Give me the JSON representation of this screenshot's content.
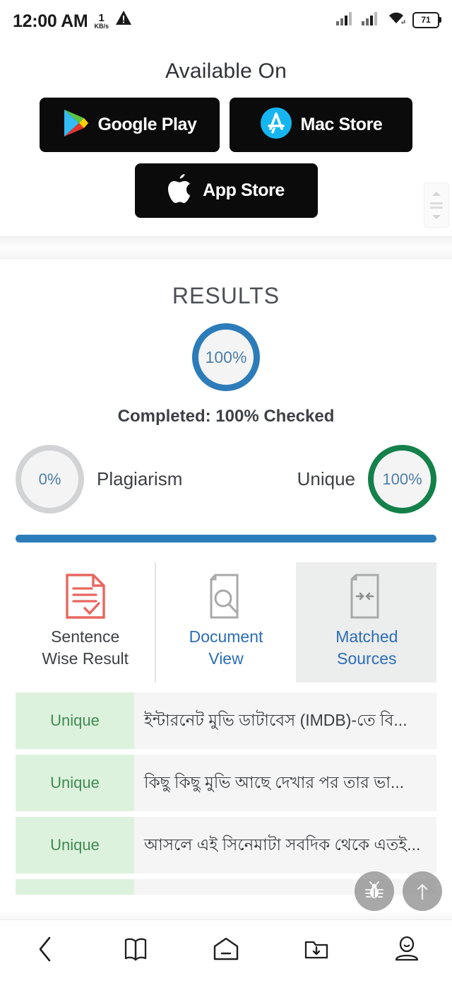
{
  "statusbar": {
    "time": "12:00 AM",
    "net_speed_value": "1",
    "net_speed_unit": "KB/s",
    "warning_icon": "warning-triangle-icon",
    "signal1_icon": "signal-bars-icon",
    "signal2_icon": "signal-bars-icon",
    "wifi_icon": "wifi-icon",
    "battery_level": "71"
  },
  "available": {
    "title": "Available On",
    "badges": [
      {
        "label": "Google Play",
        "icon": "google-play-icon"
      },
      {
        "label": "Mac Store",
        "icon": "mac-store-icon"
      },
      {
        "label": "App Store",
        "icon": "apple-icon"
      }
    ]
  },
  "scroll_widget": {
    "up_icon": "chevron-up-icon",
    "down_icon": "chevron-down-icon"
  },
  "results": {
    "title": "RESULTS",
    "main_percent": "100%",
    "completed_text": "Completed: 100% Checked",
    "plagiarism_percent": "0%",
    "plagiarism_label": "Plagiarism",
    "unique_label": "Unique",
    "unique_percent": "100%",
    "progress_percent": "100",
    "colors": {
      "main_ring": "#2d7cba",
      "plagiarism_ring": "#d2d3d4",
      "unique_ring": "#14804a",
      "progress_bar": "#2d7cba",
      "percent_text": "#4c7fa8"
    }
  },
  "tabs": [
    {
      "label": "Sentence\nWise Result",
      "line1": "Sentence",
      "line2": "Wise Result",
      "icon": "document-check-icon",
      "state": "active"
    },
    {
      "label": "Document View",
      "line1": "Document",
      "line2": "View",
      "icon": "document-search-icon",
      "state": "link"
    },
    {
      "label": "Matched Sources",
      "line1": "Matched",
      "line2": "Sources",
      "icon": "document-arrows-icon",
      "state": "link-highlighted"
    }
  ],
  "result_rows": [
    {
      "tag": "Unique",
      "text": "ইন্টারনেট মুভি ডাটাবেস (IMDB)-তে বি..."
    },
    {
      "tag": "Unique",
      "text": "কিছু কিছু মুভি আছে দেখার পর তার ভা..."
    },
    {
      "tag": "Unique",
      "text": "আসলে এই সিনেমাটা সবদিক থেকে এতই..."
    },
    {
      "tag": "",
      "text": ""
    }
  ],
  "fabs": [
    {
      "icon": "bug-report-icon"
    },
    {
      "icon": "scroll-to-top-arrow-icon"
    }
  ],
  "bottom_nav": [
    {
      "icon": "back-chevron-icon"
    },
    {
      "icon": "book-icon"
    },
    {
      "icon": "home-icon"
    },
    {
      "icon": "downloads-folder-icon"
    },
    {
      "icon": "profile-icon"
    }
  ]
}
